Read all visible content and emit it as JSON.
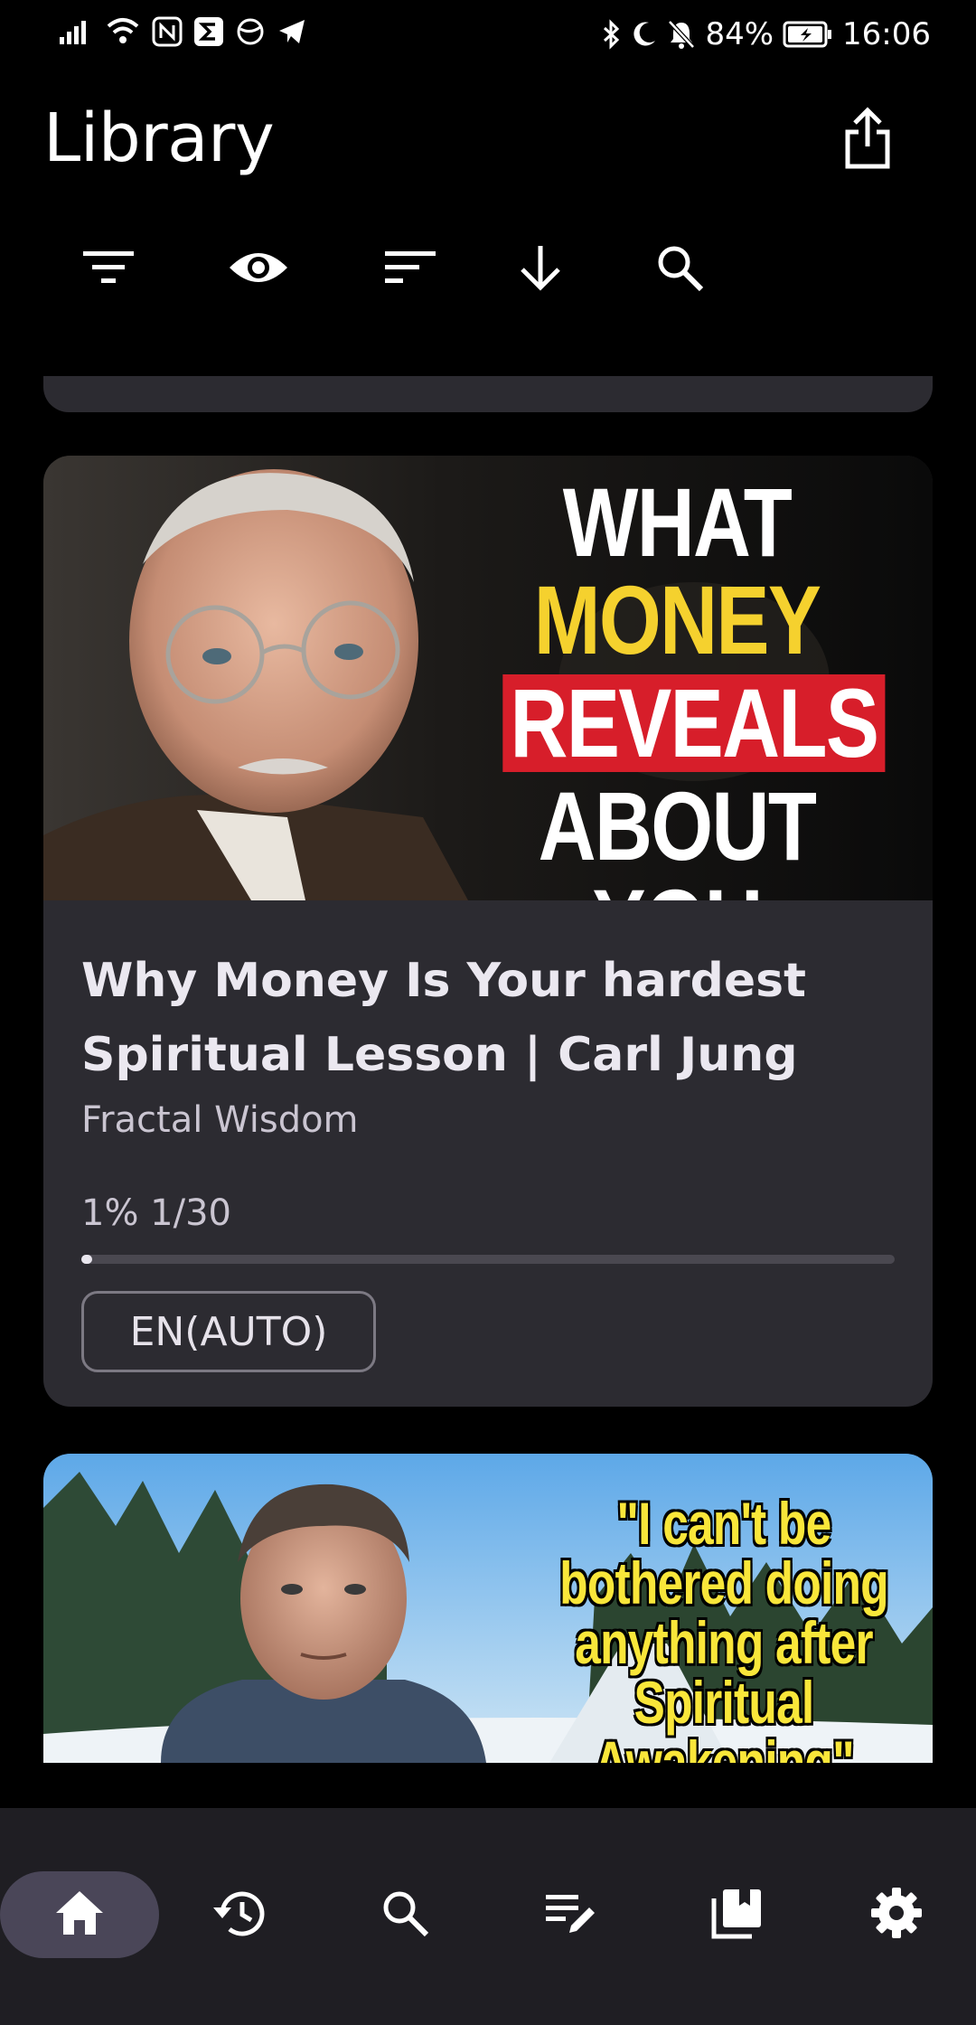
{
  "status_bar": {
    "battery_percent": "84%",
    "time": "16:06"
  },
  "header": {
    "title": "Library",
    "share_icon": "share-icon"
  },
  "toolbar": {
    "icons": [
      "filter-icon",
      "visibility-icon",
      "sort-icon",
      "download-icon",
      "search-icon"
    ]
  },
  "cards": [
    {
      "thumbnail_text": [
        "WHAT",
        "MONEY",
        "REVEALS",
        "ABOUT YOU"
      ],
      "title": "Why Money Is Your hardest Spiritual Lesson | Carl Jung",
      "channel": "Fractal Wisdom",
      "progress_label": "1% 1/30",
      "progress_fraction": 0.01,
      "language_chip": "EN(AUTO)"
    },
    {
      "thumbnail_text": "\"I can't be bothered doing anything after Spiritual Awakening\""
    }
  ],
  "bottom_nav": {
    "items": [
      "home-icon",
      "history-icon",
      "search-icon",
      "playlist-edit-icon",
      "library-icon",
      "settings-icon"
    ],
    "active": "home-icon"
  },
  "colors": {
    "card_bg": "#2c2b31",
    "nav_bg": "#1f1e23",
    "nav_active": "#4a4658",
    "headline_yellow": "#f5d12e",
    "headline_red": "#d71e2a"
  }
}
